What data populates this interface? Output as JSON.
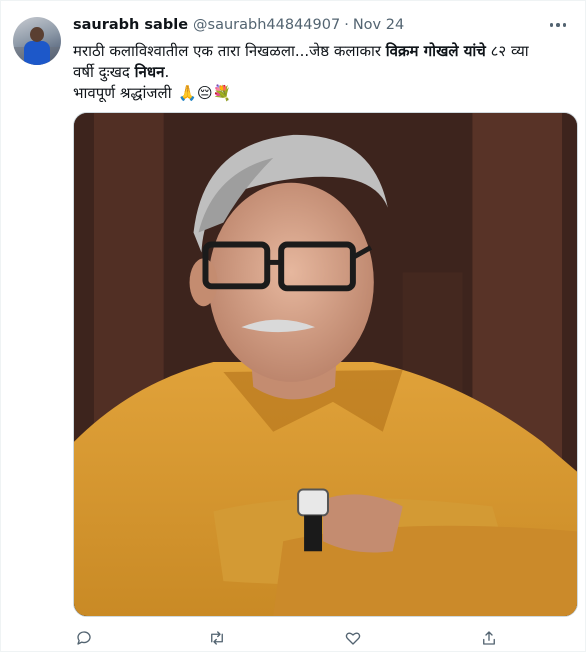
{
  "tweet": {
    "author": {
      "name": "saurabh sable",
      "handle": "@saurabh44844907",
      "separator": "·",
      "date": "Nov 24"
    },
    "text": {
      "line1_part1": "मराठी कलाविश्वातील एक तारा निखळला...जेष्ठ कलाकार ",
      "line1_bold": "विक्रम गोखले यांचे",
      "line1_part2": " ८२ व्या",
      "line2_part1": "वर्षी दुःखद ",
      "line2_bold": "निधन",
      "line2_part2": ".",
      "line3_text": "भावपूर्ण श्रद्धांजली ",
      "line3_emojis": "🙏😔💐"
    },
    "icons": {
      "more": "more-options-icon",
      "reply": "reply-icon",
      "retweet": "retweet-icon",
      "like": "like-icon",
      "share": "share-icon"
    },
    "colors": {
      "text_primary": "#0f1419",
      "text_secondary": "#536471",
      "border": "#cfd9de"
    }
  }
}
